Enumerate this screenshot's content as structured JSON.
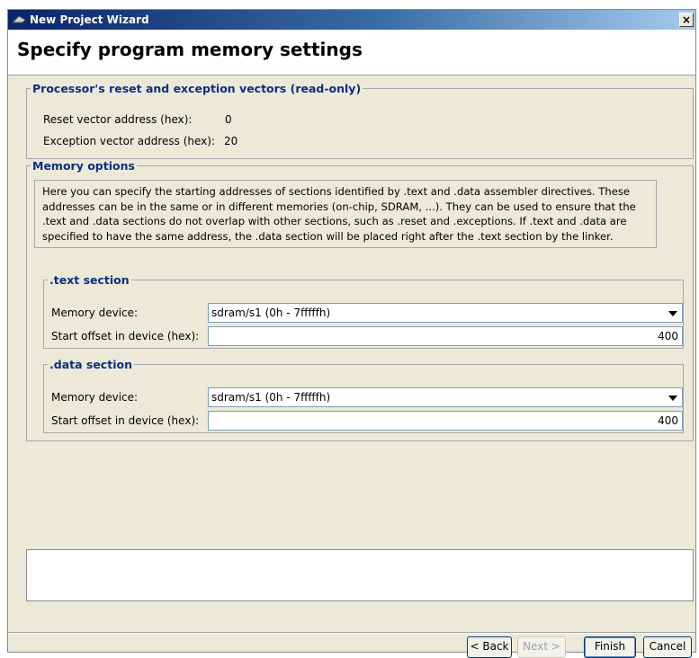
{
  "window": {
    "title": "New Project Wizard",
    "close_glyph": "×"
  },
  "header": {
    "title": "Specify program memory settings"
  },
  "vectors": {
    "legend": "Processor's reset and exception vectors (read-only)",
    "reset_label": "Reset vector address (hex):",
    "reset_value": "0",
    "exception_label": "Exception vector address (hex):",
    "exception_value": "20"
  },
  "memory": {
    "legend": "Memory options",
    "description": "Here you can specify the starting addresses of sections identified by .text and .data assembler directives. These addresses can be in the same or in different memories (on-chip, SDRAM, ...). They can be used to ensure that the .text and .data sections do not overlap with other sections, such as .reset and .exceptions. If .text and .data are specified to have the same address, the .data section will be placed right after the .text section by the linker.",
    "text_section": {
      "legend": ".text section",
      "device_label": "Memory device:",
      "device_value": "sdram/s1 (0h - 7fffffh)",
      "offset_label": "Start offset in device (hex):",
      "offset_value": "400"
    },
    "data_section": {
      "legend": ".data section",
      "device_label": "Memory device:",
      "device_value": "sdram/s1 (0h - 7fffffh)",
      "offset_label": "Start offset in device (hex):",
      "offset_value": "400"
    }
  },
  "buttons": {
    "back": "< Back",
    "next": "Next >",
    "finish": "Finish",
    "cancel": "Cancel"
  }
}
